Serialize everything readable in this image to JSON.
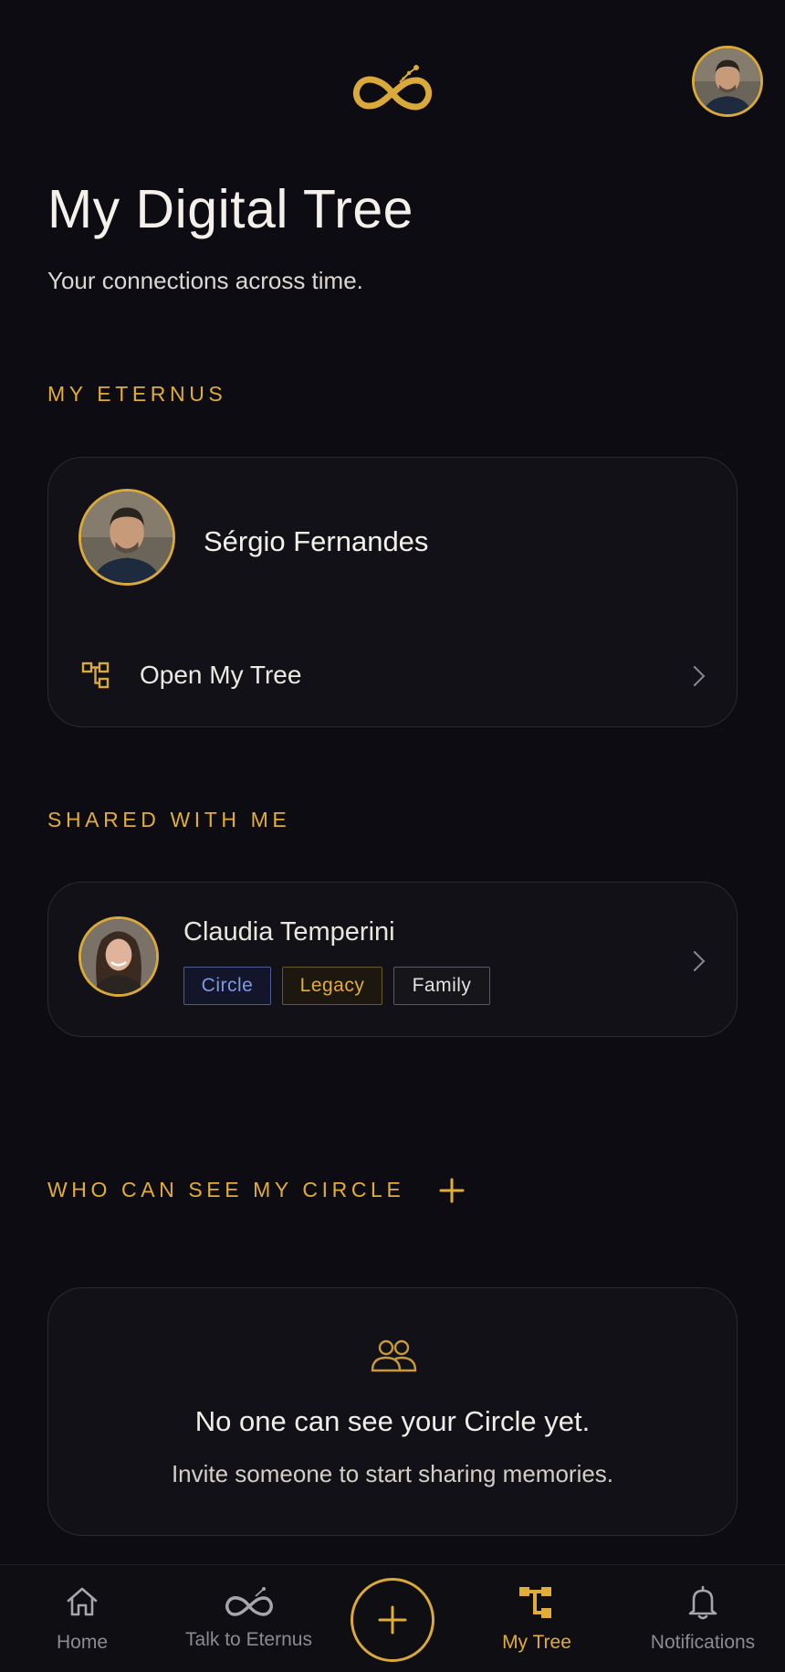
{
  "header": {
    "logo_icon": "infinity-logo-icon",
    "profile_avatar_icon": "profile-avatar"
  },
  "page": {
    "title": "My Digital Tree",
    "subtitle": "Your connections across time."
  },
  "my_eternus": {
    "section_label": "MY ETERNUS",
    "name": "Sérgio Fernandes",
    "open_tree_label": "Open My Tree",
    "open_tree_icon": "tree-hierarchy-icon"
  },
  "shared_with_me": {
    "section_label": "SHARED WITH ME",
    "items": [
      {
        "name": "Claudia Temperini",
        "tags": [
          "Circle",
          "Legacy",
          "Family"
        ]
      }
    ]
  },
  "circle_visibility": {
    "section_label": "WHO CAN SEE MY CIRCLE",
    "add_icon": "plus-icon",
    "empty_icon": "people-icon",
    "empty_title": "No one can see your Circle yet.",
    "empty_subtitle": "Invite someone to start sharing memories."
  },
  "bottom_nav": {
    "items": [
      {
        "label": "Home",
        "icon": "home-icon",
        "active": false
      },
      {
        "label": "Talk to Eternus",
        "icon": "infinity-icon",
        "active": false
      },
      {
        "label": "",
        "icon": "plus-icon",
        "active": false
      },
      {
        "label": "My Tree",
        "icon": "tree-hierarchy-icon",
        "active": true
      },
      {
        "label": "Notifications",
        "icon": "bell-icon",
        "active": false
      }
    ]
  },
  "colors": {
    "background": "#0d0c12",
    "accent_gold": "#e2ad36",
    "tag_circle": "#7f9be0",
    "card_border": "#2c2a31"
  }
}
